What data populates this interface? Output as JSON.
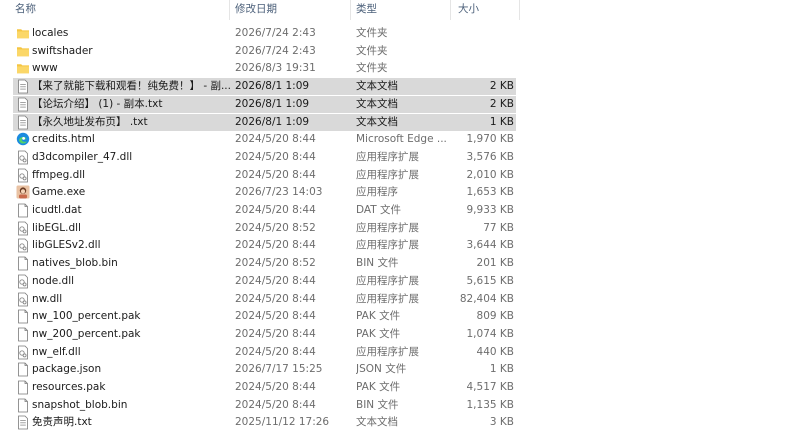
{
  "columns": {
    "name": "名称",
    "date": "修改日期",
    "type": "类型",
    "size": "大小"
  },
  "files": [
    {
      "name": "locales",
      "date": "2026/7/24 2:43",
      "type": "文件夹",
      "size": "",
      "icon": "folder-icon",
      "selected": false
    },
    {
      "name": "swiftshader",
      "date": "2026/7/24 2:43",
      "type": "文件夹",
      "size": "",
      "icon": "folder-icon",
      "selected": false
    },
    {
      "name": "www",
      "date": "2026/8/3 19:31",
      "type": "文件夹",
      "size": "",
      "icon": "folder-icon",
      "selected": false
    },
    {
      "name": "【来了就能下载和观看！纯免费！】 - 副...",
      "date": "2026/8/1 1:09",
      "type": "文本文档",
      "size": "2 KB",
      "icon": "text-file-icon",
      "selected": true
    },
    {
      "name": "【论坛介绍】 (1) - 副本.txt",
      "date": "2026/8/1 1:09",
      "type": "文本文档",
      "size": "2 KB",
      "icon": "text-file-icon",
      "selected": true
    },
    {
      "name": "【永久地址发布页】 .txt",
      "date": "2026/8/1 1:09",
      "type": "文本文档",
      "size": "1 KB",
      "icon": "text-file-icon",
      "selected": true
    },
    {
      "name": "credits.html",
      "date": "2024/5/20 8:44",
      "type": "Microsoft Edge ...",
      "size": "1,970 KB",
      "icon": "edge-icon",
      "selected": false
    },
    {
      "name": "d3dcompiler_47.dll",
      "date": "2024/5/20 8:44",
      "type": "应用程序扩展",
      "size": "3,576 KB",
      "icon": "dll-icon",
      "selected": false
    },
    {
      "name": "ffmpeg.dll",
      "date": "2024/5/20 8:44",
      "type": "应用程序扩展",
      "size": "2,010 KB",
      "icon": "dll-icon",
      "selected": false
    },
    {
      "name": "Game.exe",
      "date": "2026/7/23 14:03",
      "type": "应用程序",
      "size": "1,653 KB",
      "icon": "game-exe-icon",
      "selected": false
    },
    {
      "name": "icudtl.dat",
      "date": "2024/5/20 8:44",
      "type": "DAT 文件",
      "size": "9,933 KB",
      "icon": "blank-file-icon",
      "selected": false
    },
    {
      "name": "libEGL.dll",
      "date": "2024/5/20 8:52",
      "type": "应用程序扩展",
      "size": "77 KB",
      "icon": "dll-icon",
      "selected": false
    },
    {
      "name": "libGLESv2.dll",
      "date": "2024/5/20 8:44",
      "type": "应用程序扩展",
      "size": "3,644 KB",
      "icon": "dll-icon",
      "selected": false
    },
    {
      "name": "natives_blob.bin",
      "date": "2024/5/20 8:52",
      "type": "BIN 文件",
      "size": "201 KB",
      "icon": "blank-file-icon",
      "selected": false
    },
    {
      "name": "node.dll",
      "date": "2024/5/20 8:44",
      "type": "应用程序扩展",
      "size": "5,615 KB",
      "icon": "dll-icon",
      "selected": false
    },
    {
      "name": "nw.dll",
      "date": "2024/5/20 8:44",
      "type": "应用程序扩展",
      "size": "82,404 KB",
      "icon": "dll-icon",
      "selected": false
    },
    {
      "name": "nw_100_percent.pak",
      "date": "2024/5/20 8:44",
      "type": "PAK 文件",
      "size": "809 KB",
      "icon": "blank-file-icon",
      "selected": false
    },
    {
      "name": "nw_200_percent.pak",
      "date": "2024/5/20 8:44",
      "type": "PAK 文件",
      "size": "1,074 KB",
      "icon": "blank-file-icon",
      "selected": false
    },
    {
      "name": "nw_elf.dll",
      "date": "2024/5/20 8:44",
      "type": "应用程序扩展",
      "size": "440 KB",
      "icon": "dll-icon",
      "selected": false
    },
    {
      "name": "package.json",
      "date": "2026/7/17 15:25",
      "type": "JSON 文件",
      "size": "1 KB",
      "icon": "blank-file-icon",
      "selected": false
    },
    {
      "name": "resources.pak",
      "date": "2024/5/20 8:44",
      "type": "PAK 文件",
      "size": "4,517 KB",
      "icon": "blank-file-icon",
      "selected": false
    },
    {
      "name": "snapshot_blob.bin",
      "date": "2024/5/20 8:44",
      "type": "BIN 文件",
      "size": "1,135 KB",
      "icon": "blank-file-icon",
      "selected": false
    },
    {
      "name": "免责声明.txt",
      "date": "2025/11/12 17:26",
      "type": "文本文档",
      "size": "3 KB",
      "icon": "text-file-icon",
      "selected": false
    }
  ]
}
